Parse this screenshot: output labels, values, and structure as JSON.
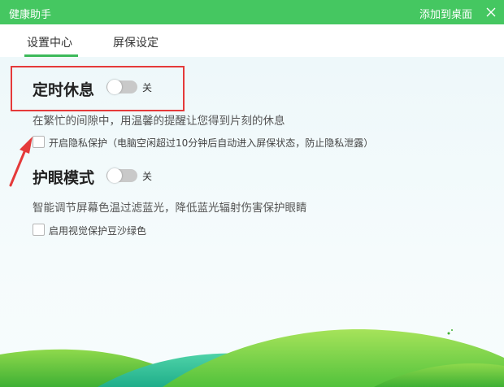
{
  "window": {
    "title": "健康助手",
    "add_to_desktop": "添加到桌面"
  },
  "tabs": [
    {
      "label": "设置中心",
      "active": true
    },
    {
      "label": "屏保设定",
      "active": false
    }
  ],
  "rest": {
    "title": "定时休息",
    "toggle_state": "关",
    "description": "在繁忙的间隙中，用温馨的提醒让您得到片刻的休息",
    "privacy_checkbox": "开启隐私保护（电脑空闲超过10分钟后自动进入屏保状态，防止隐私泄露）"
  },
  "eye": {
    "title": "护眼模式",
    "toggle_state": "关",
    "description": "智能调节屏幕色温过滤蓝光，降低蓝光辐射伤害保护眼睛",
    "green_checkbox": "启用视觉保护豆沙绿色"
  },
  "colors": {
    "titlebar": "#45c761",
    "highlight": "#e53a3a",
    "tab_underline": "#3cb95a"
  }
}
